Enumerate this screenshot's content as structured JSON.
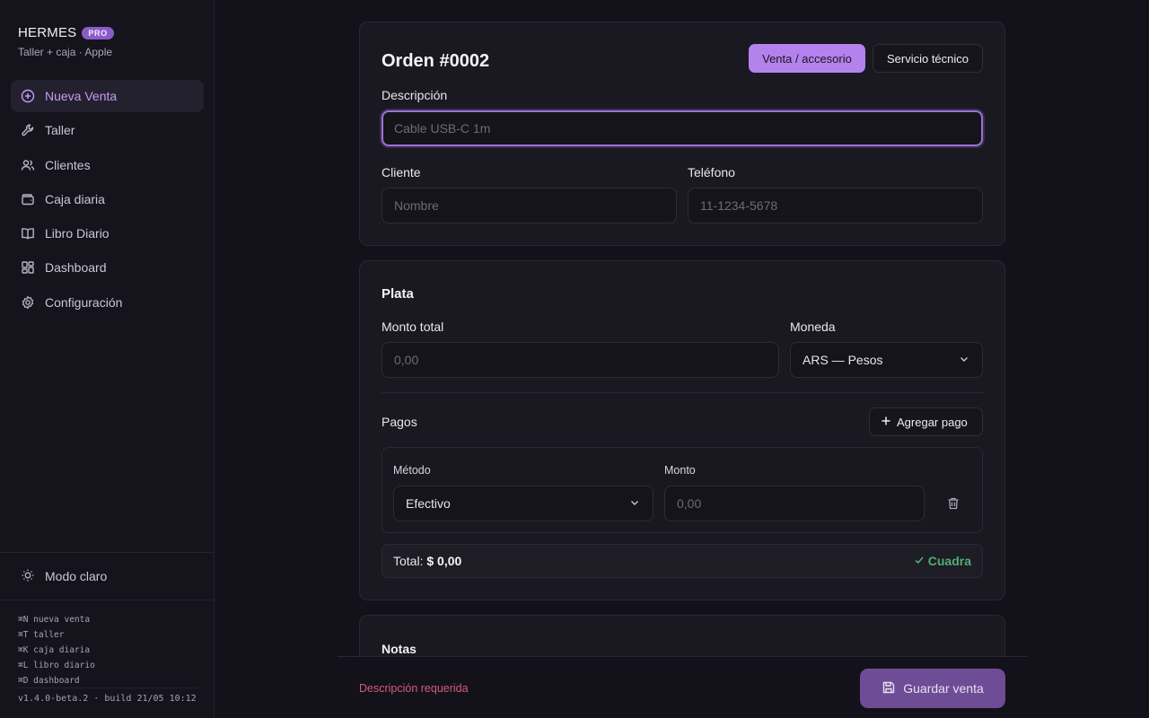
{
  "brand": {
    "title": "HERMES",
    "badge": "PRO",
    "subtitle": "Taller + caja · Apple"
  },
  "sidebar": {
    "items": [
      {
        "label": "Nueva Venta",
        "icon": "plus-circle-icon",
        "active": true
      },
      {
        "label": "Taller",
        "icon": "wrench-icon"
      },
      {
        "label": "Clientes",
        "icon": "users-icon"
      },
      {
        "label": "Caja diaria",
        "icon": "wallet-icon"
      },
      {
        "label": "Libro Diario",
        "icon": "book-icon"
      },
      {
        "label": "Dashboard",
        "icon": "dashboard-icon"
      },
      {
        "label": "Configuración",
        "icon": "gear-icon"
      }
    ],
    "theme_toggle": "Modo claro",
    "shortcuts": [
      "⌘N nueva venta",
      "⌘T taller",
      "⌘K caja diaria",
      "⌘L libro diario",
      "⌘D dashboard"
    ],
    "version": "v1.4.0-beta.2 · build 21/05 10:12"
  },
  "order": {
    "title": "Orden #0002",
    "mode_sale": "Venta / accesorio",
    "mode_service": "Servicio técnico",
    "description_label": "Descripción",
    "description_placeholder": "Cable USB-C 1m",
    "client_label": "Cliente",
    "client_placeholder": "Nombre",
    "phone_label": "Teléfono",
    "phone_placeholder": "11-1234-5678"
  },
  "money": {
    "title": "Plata",
    "total_label": "Monto total",
    "total_placeholder": "0,00",
    "currency_label": "Moneda",
    "currency_value": "ARS — Pesos",
    "payments_label": "Pagos",
    "add_payment": "Agregar pago",
    "method_label": "Método",
    "method_value": "Efectivo",
    "amount_label": "Monto",
    "amount_placeholder": "0,00",
    "total_text": "Total:",
    "total_value": "$ 0,00",
    "balance_status": "Cuadra"
  },
  "notes": {
    "title": "Notas"
  },
  "footer": {
    "error": "Descripción requerida",
    "save": "Guardar venta"
  },
  "colors": {
    "accent": "#b482ec",
    "success": "#4fae71",
    "error": "#d65b7d"
  }
}
